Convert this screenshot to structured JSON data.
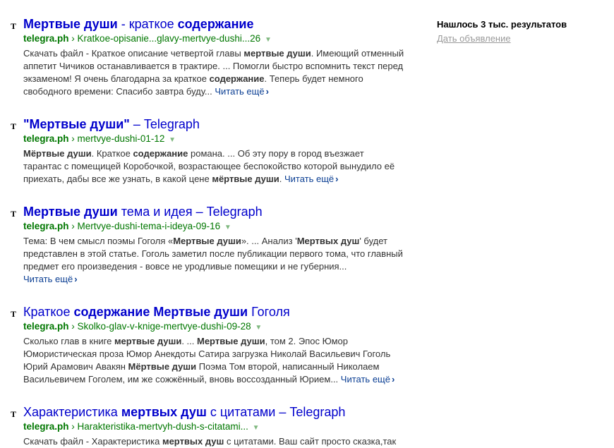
{
  "sidebar": {
    "found": "Нашлось 3 тыс. результатов",
    "ad_link": "Дать объявление"
  },
  "results": [
    {
      "favicon": "Т",
      "title_parts": [
        {
          "t": "Мертвые души",
          "b": true
        },
        {
          "t": " - краткое ",
          "b": false
        },
        {
          "t": "содержание",
          "b": true
        }
      ],
      "domain": "telegra.ph",
      "path": "Kratkoe-opisanie...glavy-mertvye-dushi...26",
      "snippet_parts": [
        {
          "t": "Скачать файл - Краткое описание четвертой главы ",
          "b": false
        },
        {
          "t": "мертвые души",
          "b": true
        },
        {
          "t": ". Имеющий отменный аппетит Чичиков останавливается в трактире. ... Помогли быстро вспомнить текст перед экзаменом! Я очень благодарна за краткое ",
          "b": false
        },
        {
          "t": "содержание",
          "b": true
        },
        {
          "t": ". Теперь будет немного свободного времени: Спасибо завтра буду...",
          "b": false
        }
      ],
      "more": "Читать ещё"
    },
    {
      "favicon": "Т",
      "title_parts": [
        {
          "t": "\"Мертвые души\"",
          "b": true
        },
        {
          "t": " – Telegraph",
          "b": false
        }
      ],
      "domain": "telegra.ph",
      "path": "mertvye-dushi-01-12",
      "snippet_parts": [
        {
          "t": "Мёртвые души",
          "b": true
        },
        {
          "t": ". Краткое ",
          "b": false
        },
        {
          "t": "содержание",
          "b": true
        },
        {
          "t": " романа. ... Об эту пору в город въезжает тарантас с помещицей Коробочкой, возрастающее беспокойство которой вынудило её приехать, дабы все же узнать, в какой цене ",
          "b": false
        },
        {
          "t": "мёртвые души",
          "b": true
        },
        {
          "t": ".",
          "b": false
        }
      ],
      "more": "Читать ещё"
    },
    {
      "favicon": "Т",
      "title_parts": [
        {
          "t": "Мертвые души",
          "b": true
        },
        {
          "t": " тема и идея – Telegraph",
          "b": false
        }
      ],
      "domain": "telegra.ph",
      "path": "Mertvye-dushi-tema-i-ideya-09-16",
      "snippet_parts": [
        {
          "t": "Тема: В чем смысл поэмы Гоголя «",
          "b": false
        },
        {
          "t": "Мертвые души",
          "b": true
        },
        {
          "t": "». ... Анализ '",
          "b": false
        },
        {
          "t": "Мертвых душ",
          "b": true
        },
        {
          "t": "' будет представлен в этой статье. Гоголь заметил после публикации первого тома, что главный предмет его произведения - вовсе не уродливые помещики и не губерния...",
          "b": false
        }
      ],
      "more_newline": true,
      "more": "Читать ещё"
    },
    {
      "favicon": "Т",
      "title_parts": [
        {
          "t": "Краткое ",
          "b": false
        },
        {
          "t": "содержание Мертвые души",
          "b": true
        },
        {
          "t": " Гоголя",
          "b": false
        }
      ],
      "domain": "telegra.ph",
      "path": "Skolko-glav-v-knige-mertvye-dushi-09-28",
      "snippet_parts": [
        {
          "t": "Сколько глав в книге ",
          "b": false
        },
        {
          "t": "мертвые души",
          "b": true
        },
        {
          "t": ". ... ",
          "b": false
        },
        {
          "t": "Мертвые души",
          "b": true
        },
        {
          "t": ", том 2. Эпос Юмор Юмористическая проза Юмор Анекдоты Сатира загрузка Николай Васильевич Гоголь Юрий Арамович Авакян ",
          "b": false
        },
        {
          "t": "Мёртвые души",
          "b": true
        },
        {
          "t": " Поэма Том второй, написанный Николаем Васильевичем Гоголем, им же сожжённый, вновь воссозданный Юрием...",
          "b": false
        }
      ],
      "more": "Читать ещё"
    },
    {
      "favicon": "Т",
      "title_parts": [
        {
          "t": "Характеристика ",
          "b": false
        },
        {
          "t": "мертвых душ",
          "b": true
        },
        {
          "t": " с цитатами – Telegraph",
          "b": false
        }
      ],
      "domain": "telegra.ph",
      "path": "Harakteristika-mertvyh-dush-s-citatami...",
      "snippet_parts": [
        {
          "t": "Скачать файл - Характеристика ",
          "b": false
        },
        {
          "t": "мертвых душ",
          "b": true
        },
        {
          "t": " с цитатами. Ваш сайт просто сказка,так",
          "b": false
        }
      ],
      "more": ""
    }
  ]
}
